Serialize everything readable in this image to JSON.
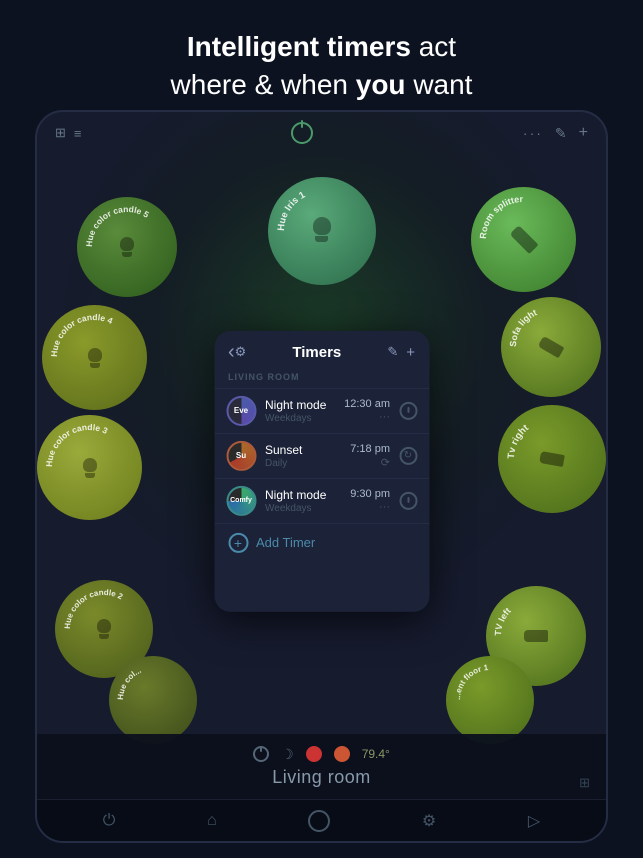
{
  "header": {
    "line1": "Intelligent timers act",
    "line2": "where & when you want",
    "bold1": "Intelligent timers",
    "bold2": "you"
  },
  "topbar": {
    "dots_label": "···",
    "more_label": "···",
    "edit_label": "✎",
    "add_label": "+"
  },
  "timers_panel": {
    "back_icon": "‹",
    "settings_icon": "⚙",
    "title": "Timers",
    "edit_icon": "✎",
    "add_icon": "+",
    "section_label": "LIVING ROOM",
    "items": [
      {
        "label": "Evening",
        "name": "Night mode",
        "schedule": "Weekdays",
        "time": "12:30 am",
        "action": "···",
        "icon_type": "power"
      },
      {
        "label": "Sunset",
        "name": "Sunset",
        "schedule": "Daily",
        "time": "7:18 pm",
        "action": "repeat",
        "icon_type": "repeat"
      },
      {
        "label": "Comfy",
        "name": "Night mode",
        "schedule": "Weekdays",
        "time": "9:30 pm",
        "action": "···",
        "icon_type": "power"
      }
    ],
    "add_timer_label": "Add Timer"
  },
  "lights": [
    {
      "id": "hue-iris",
      "name": "Hue Iris 1"
    },
    {
      "id": "room-splitter",
      "name": "Room splitter"
    },
    {
      "id": "sofa-light",
      "name": "Sofa light"
    },
    {
      "id": "tv-right",
      "name": "Tv right"
    },
    {
      "id": "tv-left",
      "name": "TV left"
    },
    {
      "id": "hue-candle-5",
      "name": "Hue color candle 5"
    },
    {
      "id": "hue-candle-4",
      "name": "Hue color candle 4"
    },
    {
      "id": "hue-candle-3",
      "name": "Hue color candle 3"
    },
    {
      "id": "hue-candle-2",
      "name": "Hue color candle 2"
    },
    {
      "id": "hue-col",
      "name": "Hue col..."
    },
    {
      "id": "floor-light",
      "name": "...ent floor 1"
    }
  ],
  "bottom_bar": {
    "room_name": "Living room",
    "temp": "79.4°"
  },
  "footer_nav": {
    "items": [
      "power",
      "home",
      "circle",
      "settings",
      "play"
    ]
  }
}
